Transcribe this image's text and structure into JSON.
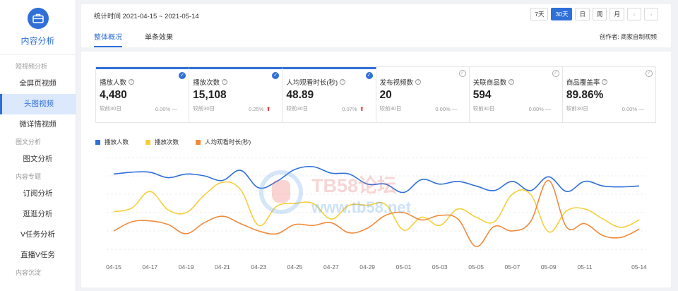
{
  "sidebar": {
    "title": "内容分析",
    "groups": [
      {
        "title": "短视频分析",
        "items": [
          {
            "label": "全屏页视频",
            "active": false
          },
          {
            "label": "头图视频",
            "active": true
          },
          {
            "label": "微详情视频",
            "active": false
          }
        ]
      },
      {
        "title": "图文分析",
        "items": [
          {
            "label": "图文分析",
            "active": false
          }
        ]
      },
      {
        "title": "内容专题",
        "items": [
          {
            "label": "订阅分析",
            "active": false
          },
          {
            "label": "逛逛分析",
            "active": false
          },
          {
            "label": "V任务分析",
            "active": false
          },
          {
            "label": "直播V任务",
            "active": false
          }
        ]
      },
      {
        "title": "内容沉淀",
        "items": []
      }
    ]
  },
  "header": {
    "period": "统计时间 2021-04-15 ~ 2021-05-14",
    "range_buttons": [
      {
        "label": "7天",
        "active": false
      },
      {
        "label": "30天",
        "active": true
      },
      {
        "label": "日",
        "active": false
      },
      {
        "label": "周",
        "active": false
      },
      {
        "label": "月",
        "active": false
      }
    ],
    "prev": "‹",
    "next": "›",
    "tabs": [
      {
        "label": "整体概况",
        "active": true
      },
      {
        "label": "单条效果",
        "active": false
      }
    ],
    "creator": "创作者: 商家自制视频"
  },
  "metrics": [
    {
      "label": "播放人数",
      "value": "4,480",
      "compare": "较前30日",
      "pct": "0.00%",
      "trend": "—",
      "trend_dir": "flat",
      "selected": true
    },
    {
      "label": "播放次数",
      "value": "15,108",
      "compare": "较前30日",
      "pct": "0.25%",
      "trend": "⬆",
      "trend_dir": "up",
      "selected": true
    },
    {
      "label": "人均观看时长(秒)",
      "value": "48.89",
      "compare": "较前30日",
      "pct": "0.07%",
      "trend": "⬆",
      "trend_dir": "up",
      "selected": true
    },
    {
      "label": "发布视频数",
      "value": "20",
      "compare": "较前30日",
      "pct": "0.00%",
      "trend": "—",
      "trend_dir": "flat",
      "selected": false
    },
    {
      "label": "关联商品数",
      "value": "594",
      "compare": "较前30日",
      "pct": "0.00%",
      "trend": "—",
      "trend_dir": "flat",
      "selected": false
    },
    {
      "label": "商品覆盖率",
      "value": "89.86%",
      "compare": "较前30日",
      "pct": "0.00%",
      "trend": "—",
      "trend_dir": "flat",
      "selected": false
    }
  ],
  "watermark": {
    "line1": "TB58论坛",
    "line2": "www.tb58.net"
  },
  "colors": {
    "accent": "#2f6fd8",
    "series1": "#2f6fd8",
    "series2": "#f5cf3a",
    "series3": "#f08a3c",
    "up": "#e23b3b"
  },
  "chart_data": {
    "type": "line",
    "x": [
      "04-15",
      "04-16",
      "04-17",
      "04-18",
      "04-19",
      "04-20",
      "04-21",
      "04-22",
      "04-23",
      "04-24",
      "04-25",
      "04-26",
      "04-27",
      "04-28",
      "04-29",
      "04-30",
      "05-01",
      "05-02",
      "05-03",
      "05-04",
      "05-05",
      "05-06",
      "05-07",
      "05-08",
      "05-09",
      "05-10",
      "05-11",
      "05-12",
      "05-13",
      "05-14"
    ],
    "tick_labels": [
      "04-15",
      "04-17",
      "04-19",
      "04-21",
      "04-23",
      "04-25",
      "04-27",
      "04-29",
      "05-01",
      "05-03",
      "05-05",
      "05-07",
      "05-09",
      "05-11",
      "05-14"
    ],
    "series": [
      {
        "name": "播放人数",
        "color": "#2f6fd8",
        "values": [
          82,
          84,
          84,
          78,
          82,
          80,
          75,
          86,
          67,
          74,
          87,
          90,
          83,
          82,
          71,
          71,
          62,
          76,
          71,
          74,
          69,
          64,
          74,
          64,
          79,
          63,
          74,
          69,
          68,
          69
        ]
      },
      {
        "name": "播放次数",
        "color": "#f5cf3a",
        "values": [
          41,
          45,
          63,
          43,
          40,
          59,
          73,
          65,
          26,
          47,
          50,
          50,
          33,
          48,
          48,
          49,
          21,
          35,
          26,
          44,
          35,
          30,
          60,
          60,
          19,
          42,
          44,
          33,
          24,
          32
        ]
      },
      {
        "name": "人均观看时长(秒)",
        "color": "#f08a3c",
        "values": [
          20,
          30,
          31,
          27,
          17,
          29,
          36,
          28,
          20,
          17,
          27,
          26,
          29,
          18,
          23,
          37,
          40,
          32,
          37,
          33,
          3,
          25,
          20,
          30,
          75,
          24,
          28,
          15,
          13,
          22
        ]
      }
    ],
    "ylim": [
      0,
      100
    ],
    "legend": "top-left",
    "grid": true
  }
}
